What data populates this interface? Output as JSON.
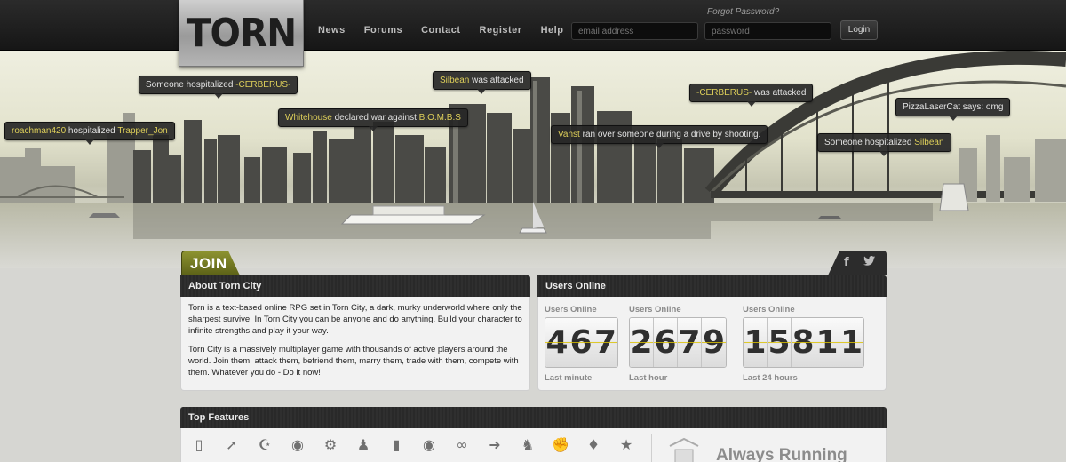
{
  "logo": {
    "text": "TORN"
  },
  "nav": {
    "items": [
      "News",
      "Forums",
      "Contact",
      "Register",
      "Help"
    ]
  },
  "login": {
    "email_placeholder": "email address",
    "password_placeholder": "password",
    "button_label": "Login",
    "forgot_label": "Forgot Password?"
  },
  "tooltips": [
    {
      "pre": "Someone hospitalized ",
      "hl": "-CERBERUS-",
      "post": ""
    },
    {
      "pre": "",
      "hl": "Silbean",
      "post": " was attacked"
    },
    {
      "pre": "",
      "hl": "-CERBERUS-",
      "post": " was attacked"
    },
    {
      "pre": "PizzaLaserCat says: omg",
      "hl": "",
      "post": ""
    },
    {
      "pre": "",
      "hl": "Whitehouse",
      "post": " declared war against ",
      "hl2": "B.O.M.B.S"
    },
    {
      "pre": "",
      "hl": "roachman420",
      "post": " hospitalized ",
      "hl2": "Trapper_Jon"
    },
    {
      "pre": "",
      "hl": "Vanst",
      "post": " ran over someone during a drive by shooting."
    },
    {
      "pre": "Someone hospitalized ",
      "hl": "Silbean",
      "post": ""
    }
  ],
  "join_tab": {
    "label": "JOIN"
  },
  "social": {
    "facebook": "f",
    "twitter": "t"
  },
  "about": {
    "title": "About Torn City",
    "para1": "Torn is a text-based online RPG set in Torn City, a dark, murky underworld where only the sharpest survive. In Torn City you can be anyone and do anything. Build your character to infinite strengths and play it your way.",
    "para2": "Torn City is a massively multiplayer game with thousands of active players around the world. Join them, attack them, befriend them, marry them, trade with them, compete with them. Whatever you do - Do it now!"
  },
  "users_online": {
    "title": "Users Online",
    "groups": [
      {
        "label_top": "Users Online",
        "digits": [
          "4",
          "6",
          "7"
        ],
        "label_bottom": "Last minute"
      },
      {
        "label_top": "Users Online",
        "digits": [
          "2",
          "6",
          "7",
          "9"
        ],
        "label_bottom": "Last hour"
      },
      {
        "label_top": "Users Online",
        "digits": [
          "1",
          "5",
          "8",
          "1",
          "1"
        ],
        "label_bottom": "Last 24 hours"
      }
    ]
  },
  "features": {
    "title": "Top Features",
    "icons": [
      "test-tube-icon",
      "knife-icon",
      "trophy-icon",
      "piggy-bank-icon",
      "gear-icon",
      "people-icon",
      "book-icon",
      "medal-icon",
      "handcuffs-icon",
      "syringe-icon",
      "graduate-icon",
      "fist-icon",
      "money-icon",
      "star-icon"
    ],
    "always_label": "Always Running"
  },
  "colors": {
    "highlight": "#dfd05a",
    "join_green": "#7a7f23",
    "dark_bar": "#2b2b2b"
  }
}
